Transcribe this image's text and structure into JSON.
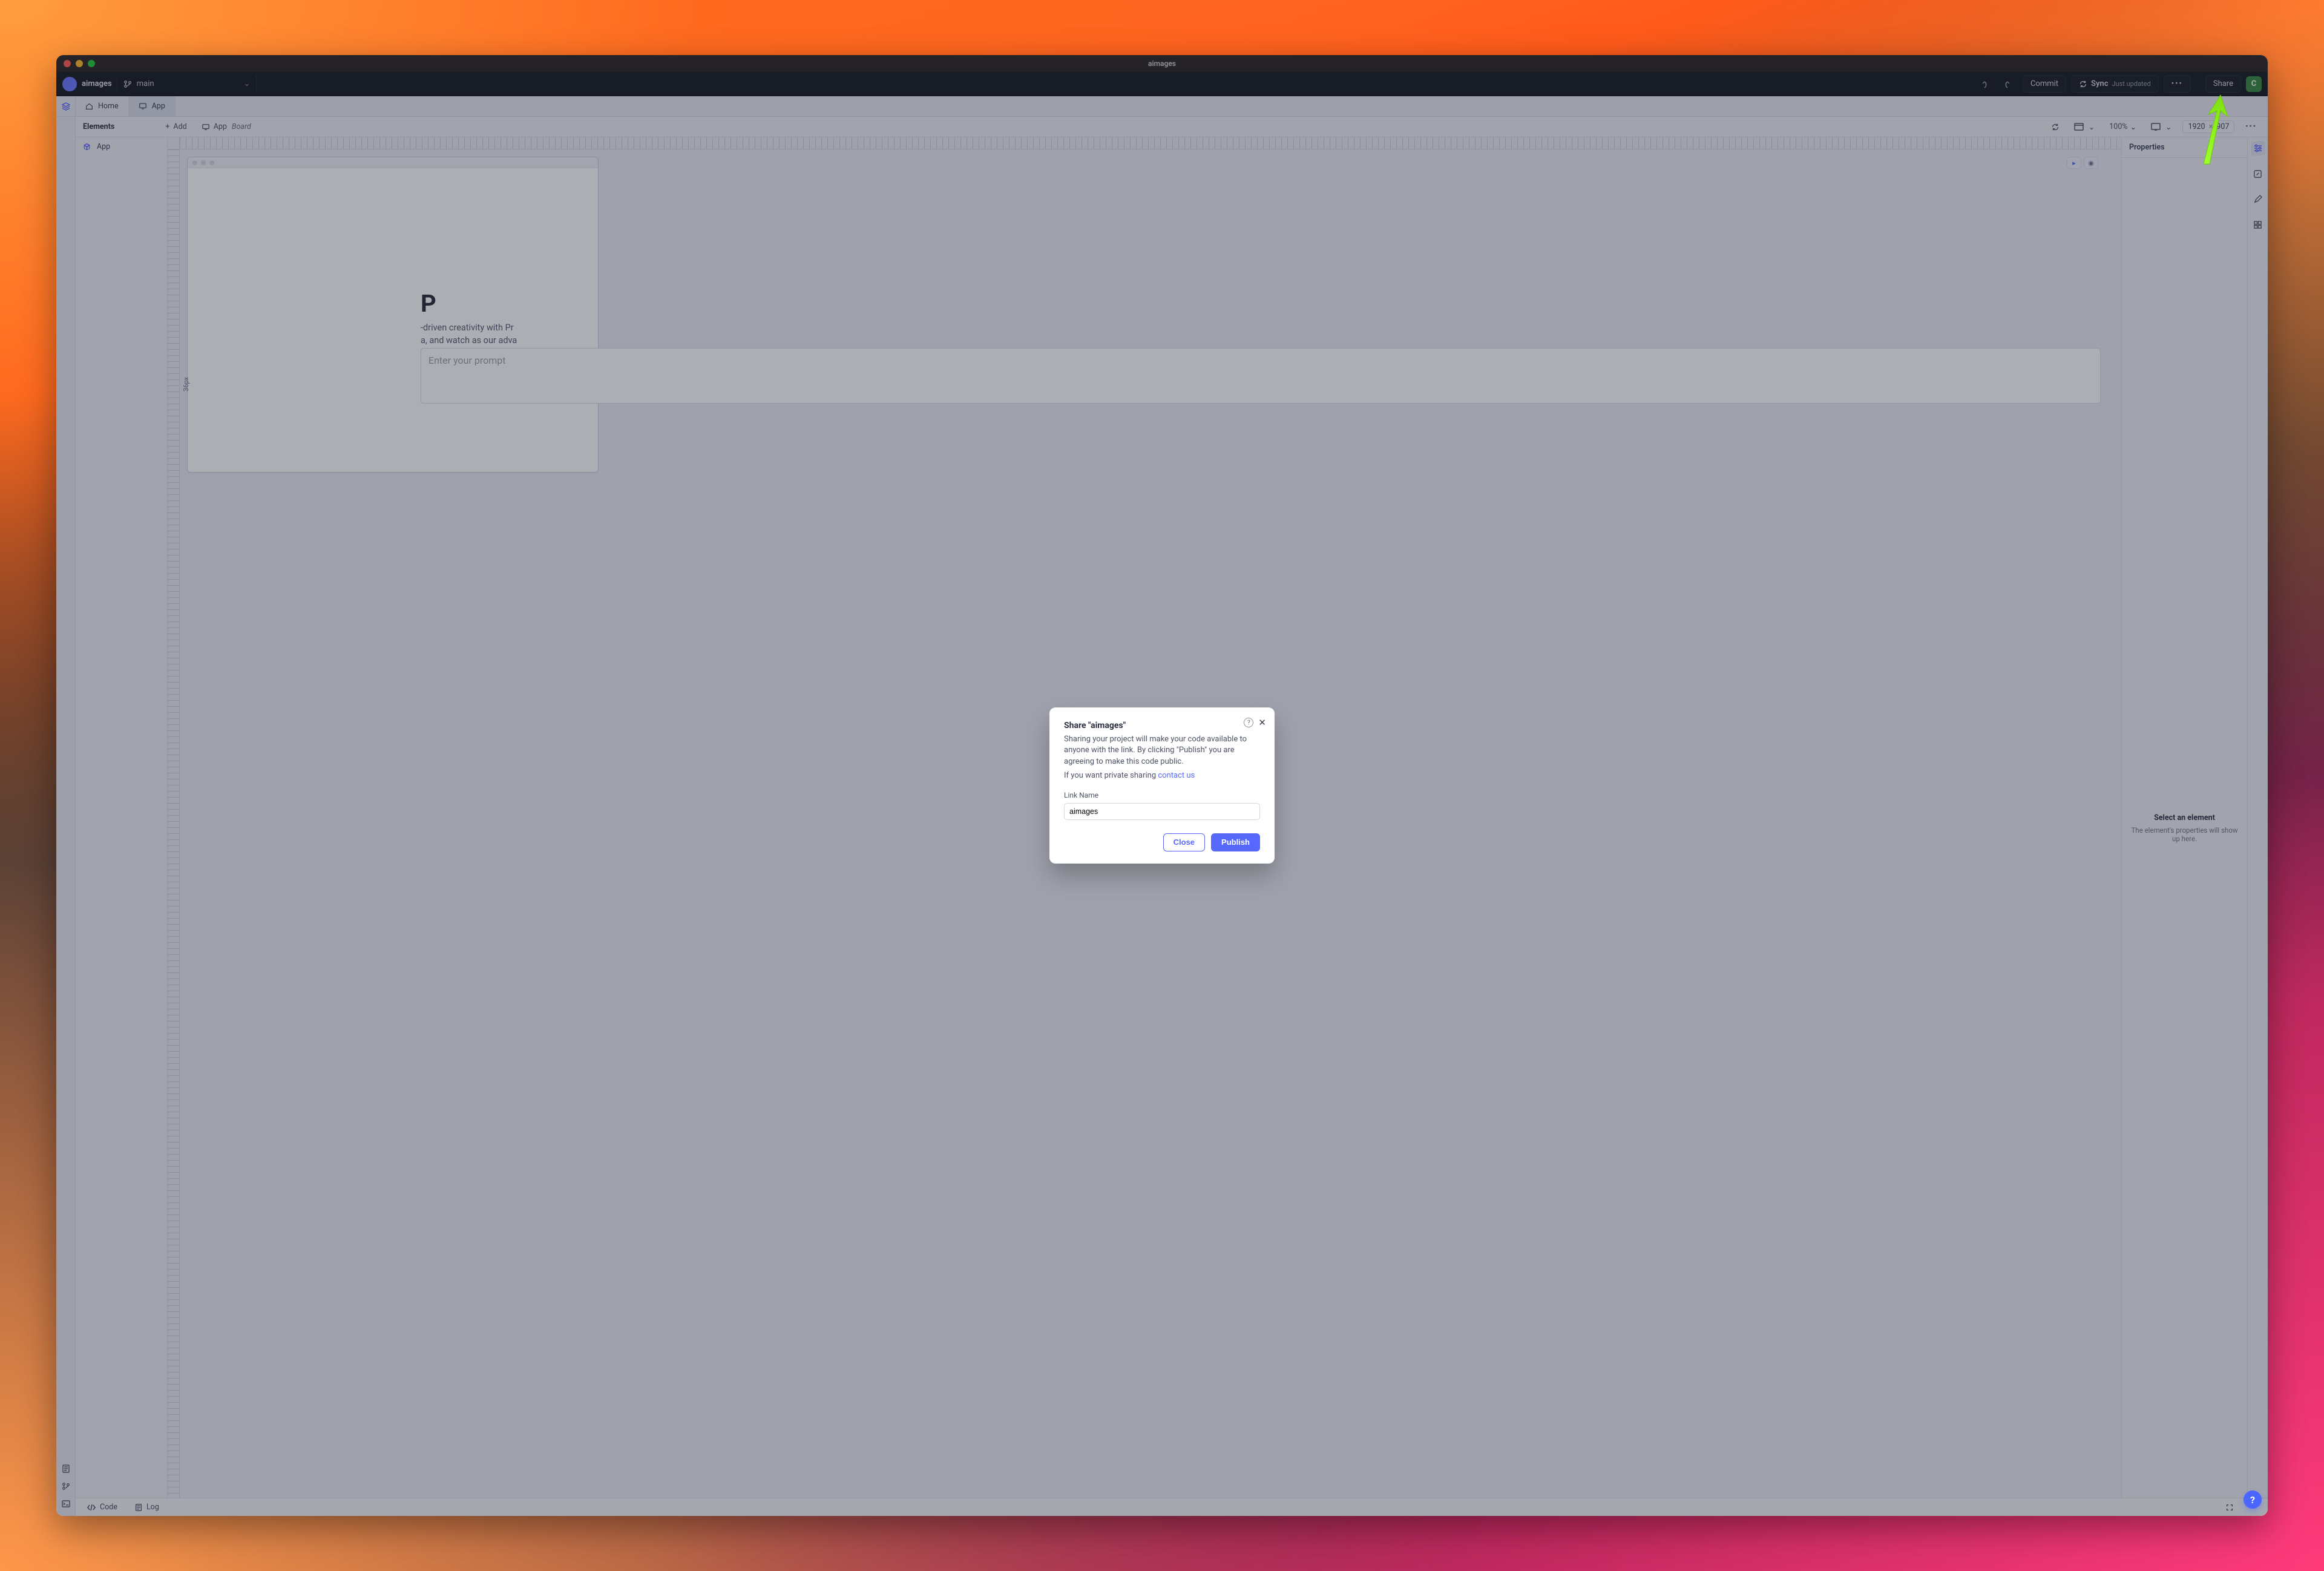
{
  "window": {
    "title": "aimages"
  },
  "menubar": {
    "app_name": "aimages",
    "branch": "main",
    "commit_label": "Commit",
    "sync_label": "Sync",
    "sync_status": "Just updated",
    "share_label": "Share",
    "avatar_initial": "C"
  },
  "tabs": {
    "home": "Home",
    "app": "App"
  },
  "toolbar": {
    "elements_label": "Elements",
    "add_label": "Add",
    "app_label": "App",
    "app_suffix": "Board",
    "zoom": "100%",
    "width": "1920",
    "height": "907"
  },
  "left_panel": {
    "root_item": "App"
  },
  "canvas": {
    "big_letter": "P",
    "body_line1": "-driven creativity with Pr",
    "body_line2": "a, and watch as our adva",
    "prompt_placeholder": "Enter your prompt",
    "measure": "36px"
  },
  "right_panel": {
    "header": "Properties",
    "empty_title": "Select an element",
    "empty_body": "The element's properties will show up here."
  },
  "footer": {
    "code": "Code",
    "log": "Log"
  },
  "help": {
    "glyph": "?"
  },
  "modal": {
    "title": "Share \"aimages\"",
    "desc": "Sharing your project will make your code available to anyone with the link. By clicking \"Publish\" you are agreeing to make this code public.",
    "private_pre": "If you want private sharing ",
    "private_link": "contact us",
    "link_name_label": "Link Name",
    "link_name_value": "aimages",
    "close": "Close",
    "publish": "Publish"
  }
}
